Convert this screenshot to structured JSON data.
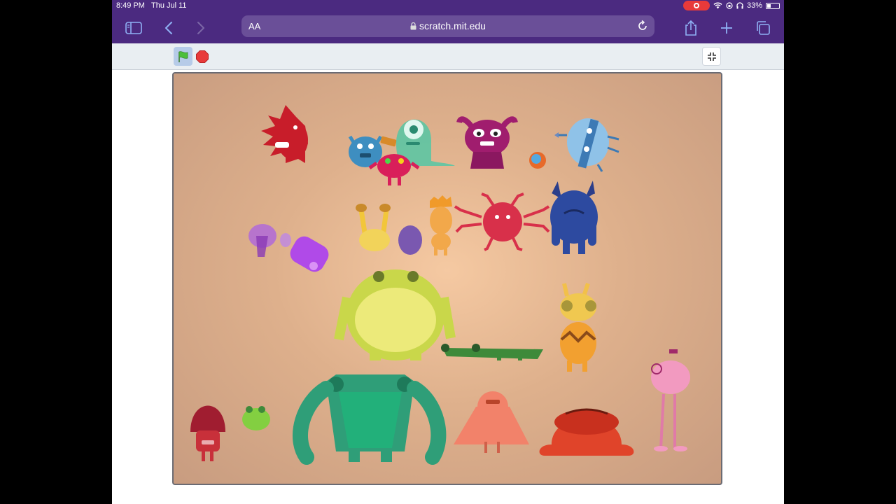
{
  "status_bar": {
    "time": "8:49 PM",
    "date": "Thu Jul 11",
    "battery_percent": "33%",
    "battery_level": 0.33
  },
  "browser": {
    "text_size_label": "AA",
    "url": "scratch.mit.edu",
    "icons": [
      "sidebar-icon",
      "back-icon",
      "forward-icon",
      "lock-icon",
      "reload-icon",
      "share-icon",
      "new-tab-icon",
      "tabs-icon"
    ]
  },
  "scratch": {
    "controls": [
      "green-flag-icon",
      "stop-icon",
      "exit-fullscreen-icon"
    ]
  },
  "stage": {
    "background_color": "#e2b38f",
    "sprites": [
      "red-spiky-monster",
      "blue-horned-monster",
      "teal-ghost-monster",
      "pink-round-monster",
      "magenta-horned-monster",
      "orange-small-monster",
      "light-blue-egg-monster",
      "purple-blob-monster",
      "purple-cylinder-monster",
      "yellow-eyestalk-monster",
      "purple-egg",
      "orange-crested-monster",
      "pink-spider-monster",
      "navy-horned-monster",
      "yellow-frog-monster",
      "green-crocodile",
      "orange-giraffe-monster",
      "pink-flamingo-monster",
      "crimson-hooded-monster",
      "green-small-frog",
      "teal-big-monster",
      "salmon-caped-monster",
      "red-crab-monster"
    ]
  },
  "colors": {
    "browser_chrome": "#4b2a80",
    "url_field": "#6a4f98",
    "scratch_header": "#e9eef2",
    "record_indicator": "#e83a3a"
  }
}
